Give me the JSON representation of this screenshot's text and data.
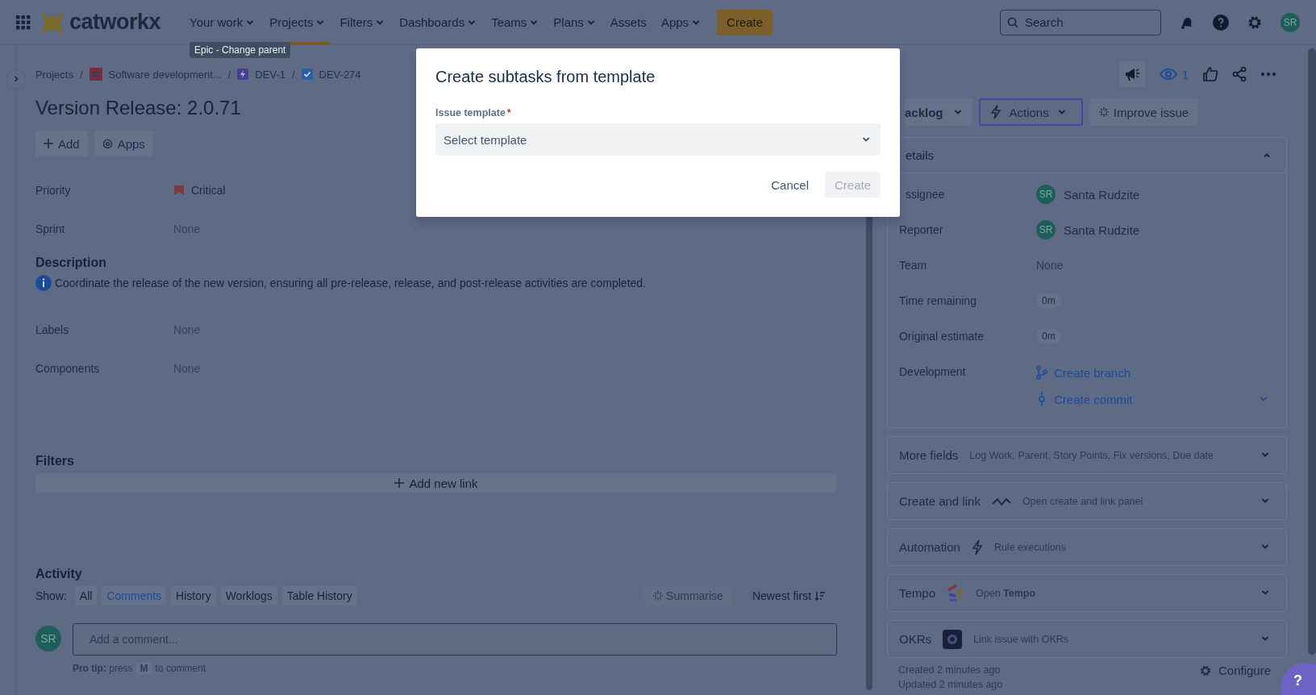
{
  "top_nav": {
    "logo": "catworkx",
    "items": [
      {
        "label": "Your work",
        "dropdown": true,
        "selected": false
      },
      {
        "label": "Projects",
        "dropdown": true,
        "selected": true
      },
      {
        "label": "Filters",
        "dropdown": true,
        "selected": false
      },
      {
        "label": "Dashboards",
        "dropdown": true,
        "selected": false
      },
      {
        "label": "Teams",
        "dropdown": true,
        "selected": false
      },
      {
        "label": "Plans",
        "dropdown": true,
        "selected": false
      },
      {
        "label": "Assets",
        "dropdown": false,
        "selected": false
      },
      {
        "label": "Apps",
        "dropdown": true,
        "selected": false
      }
    ],
    "create": "Create",
    "search": {
      "placeholder": "Search"
    },
    "avatar": "SR"
  },
  "tooltip": "Epic - Change parent",
  "breadcrumbs": [
    {
      "label": "Projects",
      "kind": "plain",
      "separator": "/"
    },
    {
      "label": "Software development...",
      "kind": "project",
      "separator": "/"
    },
    {
      "label": "DEV-1",
      "kind": "epic",
      "separator": "/"
    },
    {
      "label": "DEV-274",
      "kind": "task"
    }
  ],
  "issue": {
    "title": "Version Release: 2.0.71",
    "buttons": [
      {
        "label": "Add",
        "kind": "add"
      },
      {
        "label": "Apps",
        "kind": "apps"
      }
    ],
    "fields_top": [
      {
        "label": "Priority",
        "value": "Critical",
        "kind": "priority"
      },
      {
        "label": "Sprint",
        "value": "None"
      }
    ],
    "description": {
      "heading": "Description",
      "text": "Coordinate the release of the new version, ensuring all pre-release, release, and post-release activities are completed."
    },
    "fields_bottom": [
      {
        "label": "Labels",
        "value": "None"
      },
      {
        "label": "Components",
        "value": "None"
      }
    ],
    "filters": {
      "heading": "Filters",
      "add_link": "Add new link"
    }
  },
  "activity": {
    "heading": "Activity",
    "show_label": "Show:",
    "filters": [
      {
        "label": "All",
        "selected": false
      },
      {
        "label": "Comments",
        "selected": true
      },
      {
        "label": "History",
        "selected": false
      },
      {
        "label": "Worklogs",
        "selected": false
      },
      {
        "label": "Table History",
        "selected": false
      }
    ],
    "summarise": {
      "label": "Summarise",
      "disabled": true
    },
    "sort": "Newest first",
    "avatar": "SR",
    "comment": {
      "placeholder": "Add a comment..."
    },
    "pro_tip": {
      "before": "**Pro tip:** press",
      "key": "M",
      "after": "to comment"
    }
  },
  "side": {
    "watchers": "1",
    "status_button": "acklog",
    "actions": "Actions",
    "improve": "Improve issue",
    "details": {
      "heading": "etails",
      "expanded": true,
      "fields": [
        {
          "label": "ssignee",
          "value": "Santa Rudzite",
          "avatar": "SR",
          "kind": "person"
        },
        {
          "label": "Reporter",
          "value": "Santa Rudzite",
          "avatar": "SR",
          "kind": "person"
        },
        {
          "label": "Team",
          "value": "None",
          "kind": "plain"
        },
        {
          "label": "Time remaining",
          "value": "0m",
          "kind": "badge"
        },
        {
          "label": "Original estimate",
          "value": "0m",
          "kind": "badge"
        },
        {
          "label": "Development",
          "kind": "dev",
          "links": [
            {
              "label": "Create branch",
              "kind": "branch"
            },
            {
              "label": "Create commit",
              "kind": "commit"
            }
          ]
        }
      ]
    },
    "panels": [
      {
        "title": "More fields",
        "text": "Log Work, Parent, Story Points, Fix versions, Due date",
        "kind": "plain"
      },
      {
        "title": "Create and link",
        "text": "Open create and link panel",
        "kind": "link"
      },
      {
        "title": "Automation",
        "text": "Rule executions",
        "kind": "automation"
      },
      {
        "title": "Tempo",
        "text": "Open **Tempo**",
        "kind": "tempo"
      },
      {
        "title": "OKRs",
        "text": "Link issue with OKRs",
        "kind": "okr"
      }
    ],
    "created": "Created 2 minutes ago",
    "updated": "Updated 2 minutes ago",
    "configure": "Configure"
  },
  "help": "?",
  "modal": {
    "title": "Create subtasks from template",
    "label": "Issue template",
    "required_mark": "*",
    "select": {
      "placeholder": "Select template"
    },
    "cancel": "Cancel",
    "create": {
      "label": "Create",
      "disabled": true
    }
  }
}
